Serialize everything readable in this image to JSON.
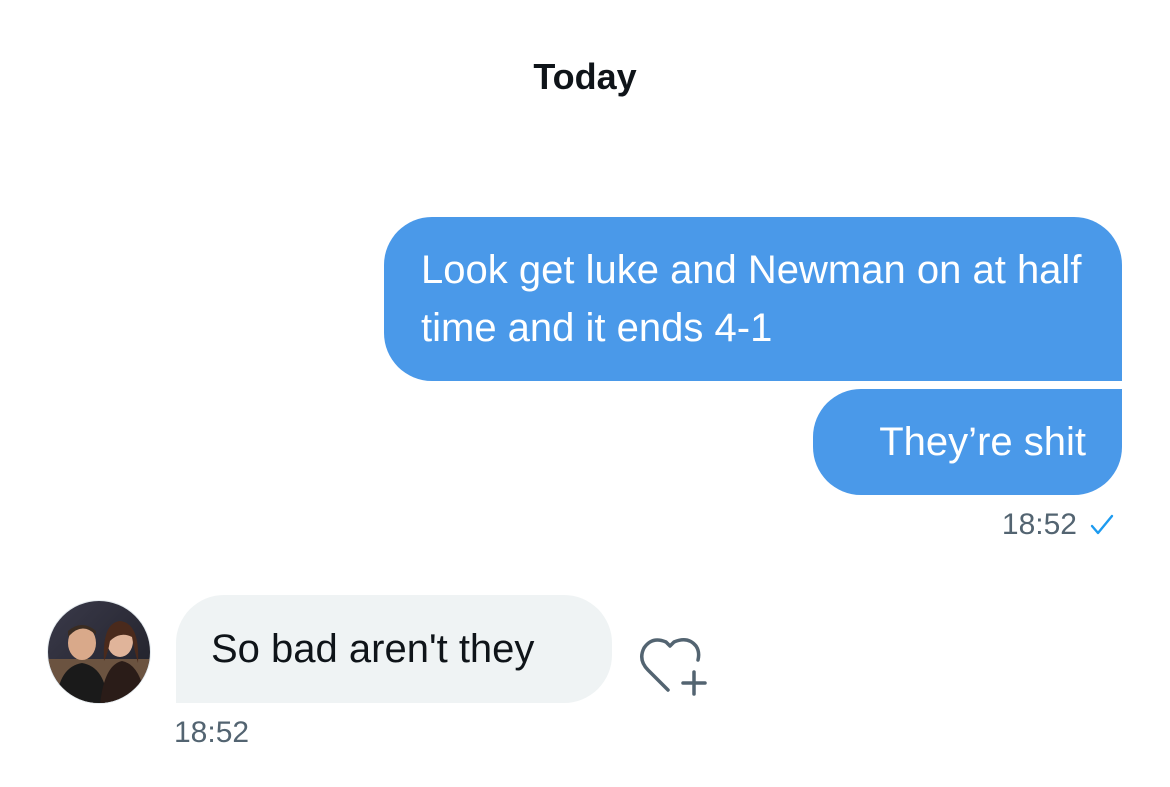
{
  "conversation": {
    "date_separator": "Today",
    "messages": [
      {
        "direction": "outgoing",
        "text": "Look get luke and Newman on at half time and it ends 4-1"
      },
      {
        "direction": "outgoing",
        "text": "They’re shit",
        "time": "18:52",
        "status_icon": "check-icon"
      },
      {
        "direction": "incoming",
        "text": "So bad aren't they",
        "time": "18:52",
        "avatar_icon": "avatar",
        "reaction_icon": "heart-plus-icon"
      }
    ]
  },
  "colors": {
    "outgoing_bubble": "#4a99e9",
    "incoming_bubble": "#eff3f4",
    "secondary_text": "#536471",
    "primary_text": "#0f1419",
    "accent": "#1d9bf0"
  }
}
